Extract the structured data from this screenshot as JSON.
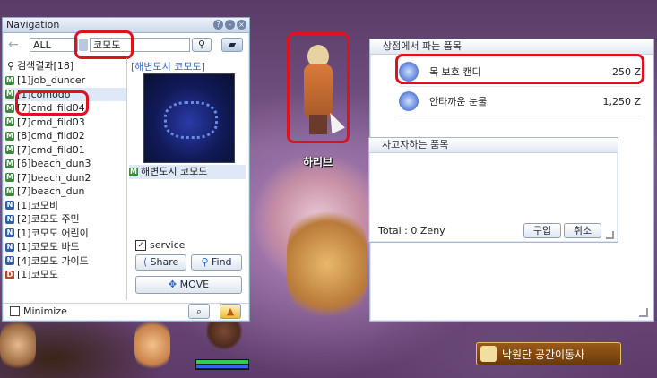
{
  "navigation": {
    "title": "Navigation",
    "filter_value": "ALL",
    "search_value": "코모도",
    "results_label": "검색결과[18]",
    "results": [
      {
        "tag": "M",
        "label": "[1]job_duncer"
      },
      {
        "tag": "M",
        "label": "[1]comodo"
      },
      {
        "tag": "M",
        "label": "[7]cmd_fild04"
      },
      {
        "tag": "M",
        "label": "[7]cmd_fild03"
      },
      {
        "tag": "M",
        "label": "[8]cmd_fild02"
      },
      {
        "tag": "M",
        "label": "[7]cmd_fild01"
      },
      {
        "tag": "M",
        "label": "[6]beach_dun3"
      },
      {
        "tag": "M",
        "label": "[7]beach_dun2"
      },
      {
        "tag": "M",
        "label": "[7]beach_dun"
      },
      {
        "tag": "N",
        "label": "[1]코모비"
      },
      {
        "tag": "N",
        "label": "[2]코모도 주민"
      },
      {
        "tag": "N",
        "label": "[1]코모도 어린이"
      },
      {
        "tag": "N",
        "label": "[1]코모도 바드"
      },
      {
        "tag": "N",
        "label": "[4]코모도 가이드"
      },
      {
        "tag": "D",
        "label": "[1]코모도"
      }
    ],
    "preview_title": "[해변도시 코모도]",
    "preview_item": "해변도시 코모도",
    "service_label": "service",
    "share_label": "Share",
    "find_label": "Find",
    "move_label": "MOVE",
    "minimize_label": "Minimize"
  },
  "npc_name": "하리브",
  "shop": {
    "sell_title": "상점에서 파는 품목",
    "items": [
      {
        "name": "목 보호 캔디",
        "price": "250 Z"
      },
      {
        "name": "안타까운 눈물",
        "price": "1,250 Z"
      }
    ],
    "buy_title": "사고자하는 품목",
    "total_label": "Total : 0 Zeny",
    "buy_button": "구입",
    "cancel_button": "취소"
  },
  "teleport_npc": "낙원단 공간이동사",
  "hp_fraction": 1.0,
  "sp_fraction": 1.0
}
